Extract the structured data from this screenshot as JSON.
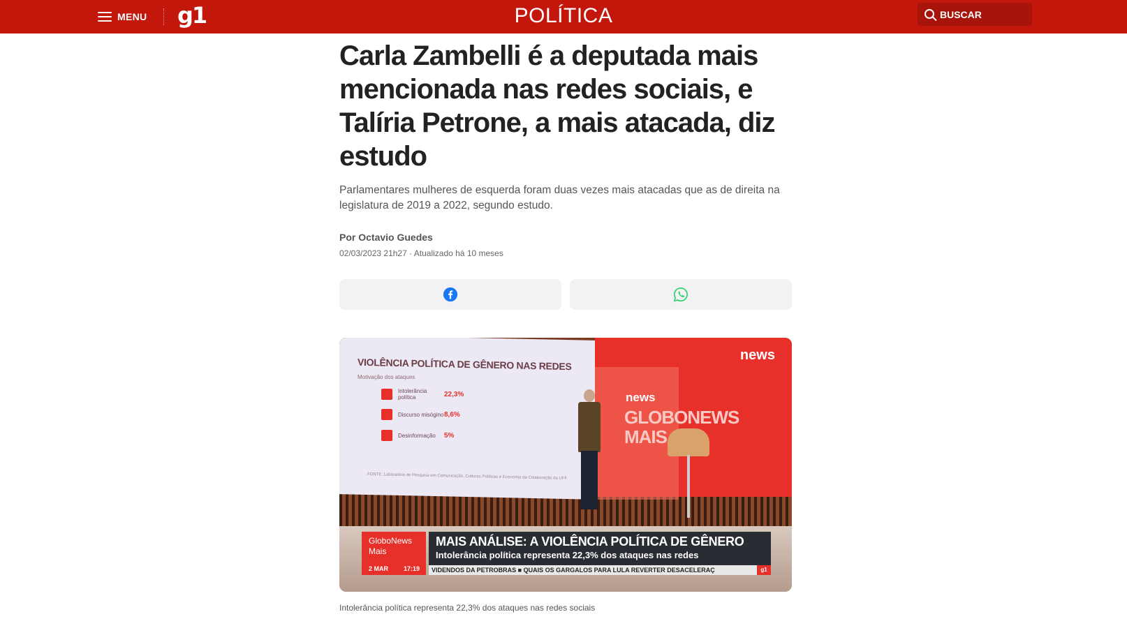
{
  "header": {
    "menu_label": "MENU",
    "logo": "g1",
    "section": "POLÍTICA",
    "search_label": "BUSCAR",
    "bg_color": "#c4170c"
  },
  "article": {
    "headline": "Carla Zambelli é a deputada mais mencionada nas redes sociais, e Talíria Petrone, a mais atacada, diz estudo",
    "subtitle": "Parlamentares mulheres de esquerda foram duas vezes mais atacadas que as de direita na legislatura de 2019 a 2022, segundo estudo.",
    "byline": "Por Octavio Guedes",
    "dateline": "02/03/2023 21h27 · Atualizado há 10 meses",
    "share": {
      "facebook_icon": "facebook-icon",
      "whatsapp_icon": "whatsapp-icon"
    },
    "caption": "Intolerância política representa 22,3% dos ataques nas redes sociais"
  },
  "video": {
    "screen_title": "VIOLÊNCIA POLÍTICA DE GÊNERO NAS REDES",
    "screen_subtitle": "Motivação dos ataques",
    "rows": [
      {
        "label": "Intolerância política",
        "value": "22,3%"
      },
      {
        "label": "Discurso misógino",
        "value": "8,6%"
      },
      {
        "label": "Desinformação",
        "value": "5%"
      }
    ],
    "source": "FONTE: Laboratório de Pesquisa em Comunicação, Culturas Políticas e Economia da Colaboração da UFF",
    "brand_top": "news",
    "brand_mid": "news",
    "brand_big": "GLOBONEWS MAIS",
    "channel": "GloboNews Mais",
    "date": "2 MAR",
    "time": "17:19",
    "lt_headline": "MAIS ANÁLISE: A VIOLÊNCIA POLÍTICA DE GÊNERO",
    "lt_sub": "Intolerância política representa 22,3% dos ataques nas redes",
    "ticker": "VIDENDOS DA PETROBRAS  ■  QUAIS OS GARGALOS PARA LULA REVERTER DESACELERAÇ",
    "badge": "g1"
  }
}
